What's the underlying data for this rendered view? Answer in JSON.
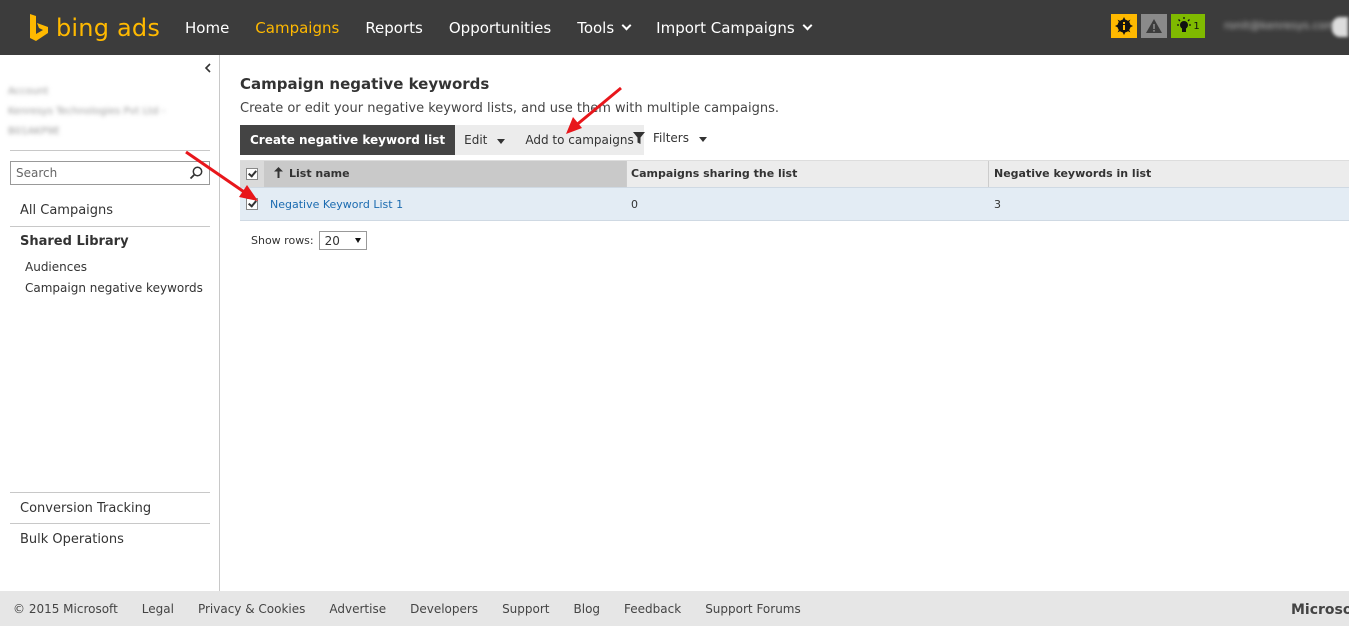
{
  "header": {
    "logo_text": "bing ads",
    "nav": [
      {
        "label": "Home"
      },
      {
        "label": "Campaigns",
        "active": true
      },
      {
        "label": "Reports"
      },
      {
        "label": "Opportunities"
      },
      {
        "label": "Tools"
      },
      {
        "label": "Import Campaigns"
      }
    ],
    "tip_count": "1",
    "user_email": "ronit@kenresys.com"
  },
  "sidebar": {
    "account_label": "Account",
    "account_name": "Kenresys Technologies Pvt Ltd -",
    "account_id": "B01AKP9E",
    "search_placeholder": "Search",
    "all_campaigns": "All Campaigns",
    "shared_library": "Shared Library",
    "audiences": "Audiences",
    "campaign_negative_keywords": "Campaign negative keywords",
    "conversion_tracking": "Conversion Tracking",
    "bulk_operations": "Bulk Operations"
  },
  "main": {
    "title": "Campaign negative keywords",
    "description": "Create or edit your negative keyword lists, and use them with multiple campaigns.",
    "toolbar": {
      "create_label": "Create negative keyword list",
      "edit_label": "Edit",
      "add_label": "Add to campaigns",
      "filters_label": "Filters"
    },
    "grid": {
      "columns": [
        "List name",
        "Campaigns sharing the list",
        "Negative keywords in list"
      ],
      "rows": [
        {
          "name": "Negative Keyword List 1",
          "campaigns": "0",
          "keywords": "3",
          "checked": true
        }
      ]
    },
    "show_rows_label": "Show rows:",
    "show_rows_value": "20"
  },
  "footer": {
    "links": [
      "© 2015 Microsoft",
      "Legal",
      "Privacy & Cookies",
      "Advertise",
      "Developers",
      "Support",
      "Blog",
      "Feedback",
      "Support Forums"
    ],
    "brand": "Microsoft"
  },
  "colors": {
    "topbar": "#3c3c3c",
    "accent": "#ffb900",
    "tip": "#7fba00",
    "link": "#1b6bb0",
    "annotation_arrow": "#e8161b"
  }
}
